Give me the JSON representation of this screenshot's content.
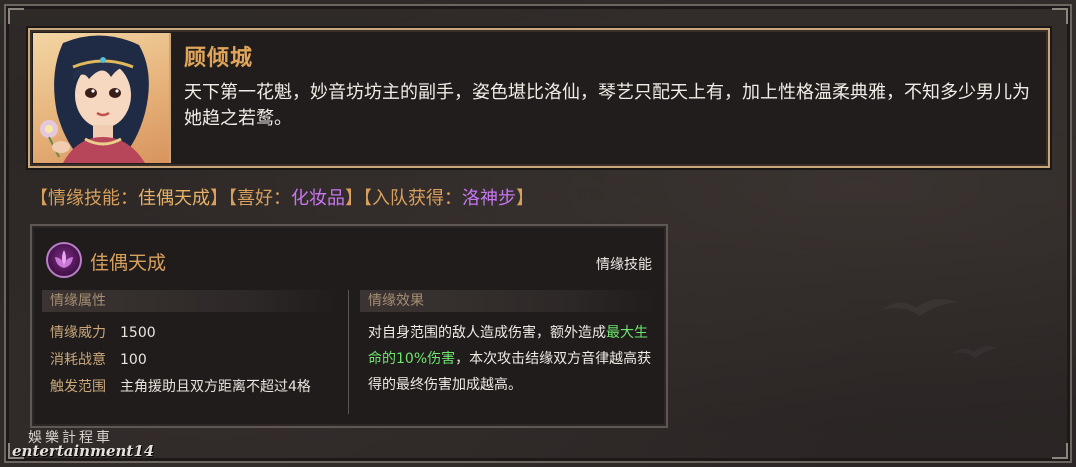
{
  "character": {
    "name": "顾倾城",
    "description": "天下第一花魁，妙音坊坊主的副手，姿色堪比洛仙，琴艺只配天上有，加上性格温柔典雅，不知多少男儿为她趋之若鹜。"
  },
  "info": {
    "skill_prefix": "【情缘技能：",
    "skill_value": "佳偶天成",
    "hobby_prefix": "】【喜好：",
    "hobby_value": "化妆品",
    "join_prefix": "】【入队获得：",
    "join_value": "洛神步",
    "suffix": "】"
  },
  "skill": {
    "name": "佳偶天成",
    "type": "情缘技能",
    "attr_header": "情缘属性",
    "effect_header": "情缘效果",
    "attributes": [
      {
        "key": "情缘威力",
        "value": "1500"
      },
      {
        "key": "消耗战意",
        "value": "100"
      },
      {
        "key": "触发范围",
        "value": "主角援助且双方距离不超过4格"
      }
    ],
    "effect_part1": "对自身范围的敌人造成伤害，额外造成",
    "effect_highlight": "最大生命的10%伤害",
    "effect_part2": "，本次攻击结缘双方音律越高获得的最终伤害加成越高。",
    "highlight_color": "#6fe56f"
  },
  "watermark": {
    "cn": "娛樂計程車",
    "en": "entertainment14"
  }
}
